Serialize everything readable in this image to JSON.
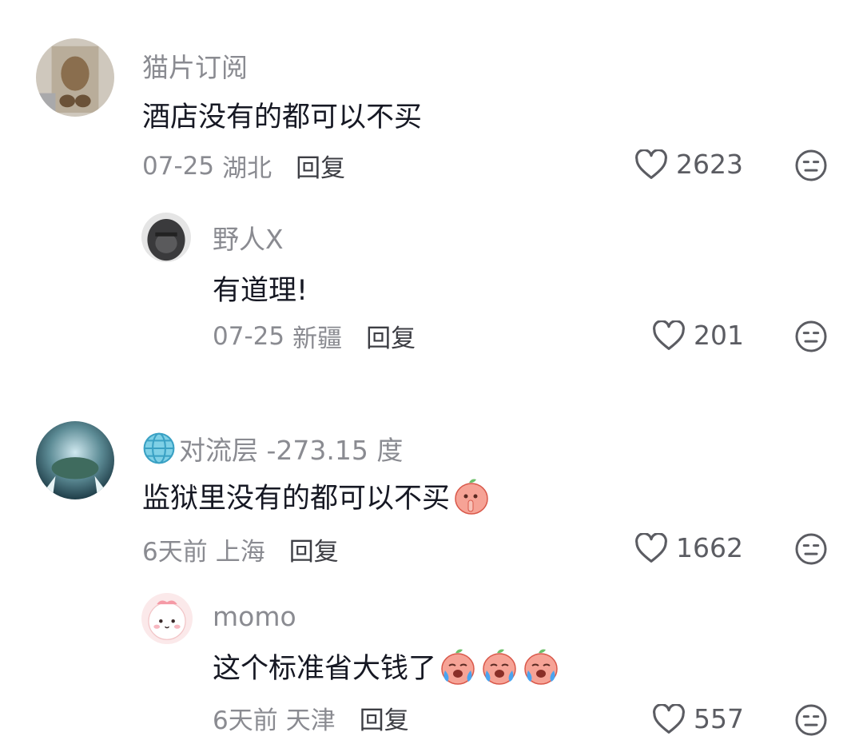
{
  "comments": [
    {
      "username": "猫片订阅",
      "text": "酒店没有的都可以不买",
      "date": "07-25",
      "region": "湖北",
      "reply_label": "回复",
      "likes": "2623"
    },
    {
      "username": "野人X",
      "text": "有道理!",
      "date": "07-25",
      "region": "新疆",
      "reply_label": "回复",
      "likes": "201"
    },
    {
      "username": "对流层 -273.15 度",
      "text": "监狱里没有的都可以不买",
      "date": "6天前",
      "region": "上海",
      "reply_label": "回复",
      "likes": "1662"
    },
    {
      "username": "momo",
      "text": "这个标准省大钱了",
      "date": "6天前",
      "region": "天津",
      "reply_label": "回复",
      "likes": "557"
    }
  ],
  "icons": {
    "like": "heart-outline-icon",
    "dislike": "meh-face-icon",
    "globe": "globe-emoji-icon",
    "emoji_shush": "peach-shush-emoji",
    "emoji_cry": "peach-cry-emoji"
  },
  "colors": {
    "username": "#8a8b91",
    "text": "#161823",
    "meta": "#8a8b91",
    "reply": "#3d3e44"
  }
}
